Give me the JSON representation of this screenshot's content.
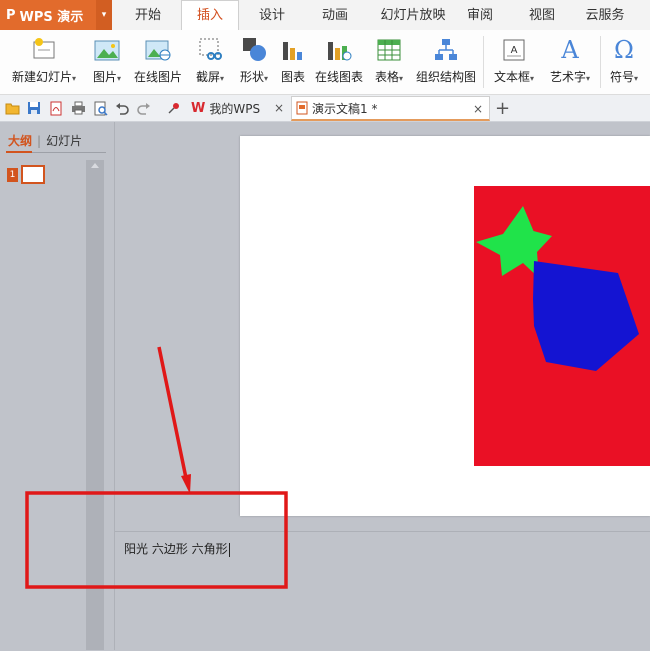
{
  "app": {
    "name": "WPS 演示",
    "logo_glyph": "P",
    "dropdown_glyph": "▾"
  },
  "menu": {
    "tabs": [
      {
        "label": "开始"
      },
      {
        "label": "插入"
      },
      {
        "label": "设计"
      },
      {
        "label": "动画"
      },
      {
        "label": "幻灯片放映"
      },
      {
        "label": "审阅"
      },
      {
        "label": "视图"
      },
      {
        "label": "云服务"
      }
    ],
    "active_index": 1
  },
  "ribbon": {
    "buttons": [
      {
        "label": "新建幻灯片",
        "icon": "new-slide-icon",
        "has_dropdown": true
      },
      {
        "label": "图片",
        "icon": "picture-icon",
        "has_dropdown": true
      },
      {
        "label": "在线图片",
        "icon": "online-picture-icon",
        "has_dropdown": false
      },
      {
        "label": "截屏",
        "icon": "screenshot-icon",
        "has_dropdown": true
      },
      {
        "label": "形状",
        "icon": "shapes-icon",
        "has_dropdown": true
      },
      {
        "label": "图表",
        "icon": "chart-icon",
        "has_dropdown": false
      },
      {
        "label": "在线图表",
        "icon": "online-chart-icon",
        "has_dropdown": false
      },
      {
        "label": "表格",
        "icon": "table-icon",
        "has_dropdown": true
      },
      {
        "label": "组织结构图",
        "icon": "org-chart-icon",
        "has_dropdown": false
      },
      {
        "label": "文本框",
        "icon": "textbox-icon",
        "has_dropdown": true
      },
      {
        "label": "艺术字",
        "icon": "wordart-icon",
        "has_dropdown": true
      },
      {
        "label": "符号",
        "icon": "symbol-icon",
        "has_dropdown": true
      }
    ],
    "dropdown_arrow": "▾"
  },
  "quickbar": {
    "icons": [
      "open-icon",
      "save-icon",
      "pdf-icon",
      "print-icon",
      "print-preview-icon",
      "undo-icon",
      "redo-icon",
      "pin-icon"
    ],
    "doc_tabs": [
      {
        "label": "我的WPS",
        "icon": "wps-home-icon",
        "close": "×"
      },
      {
        "label": "演示文稿1 *",
        "icon": "presentation-doc-icon",
        "close": "×"
      }
    ],
    "new_tab": "+"
  },
  "left_panel": {
    "tab_outline": "大纲",
    "tab_separator": "|",
    "tab_slides": "幻灯片",
    "slide_number": "1"
  },
  "slide": {
    "colors": {
      "background": "#ffffff",
      "rectangle": "#ea1025",
      "star": "#20e34a",
      "hexagon": "#1414d2"
    }
  },
  "notes": {
    "text": "阳光 六边形 六角形"
  },
  "annotation": {
    "color": "#e01818"
  }
}
